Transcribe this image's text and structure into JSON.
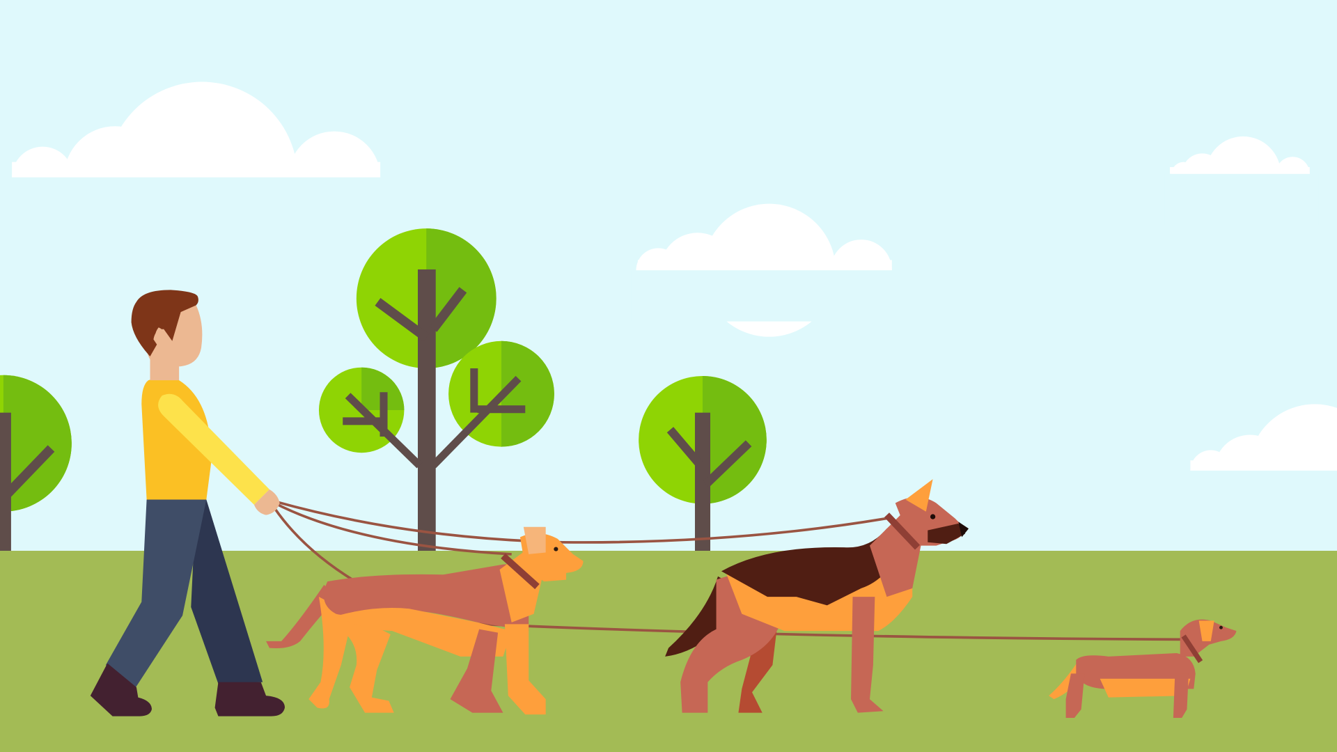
{
  "scene": {
    "description_tags": [
      "person-walking-dogs",
      "park",
      "flat-illustration"
    ],
    "colors": {
      "sky": "#dff9fc",
      "grass": "#a3bb55",
      "cloud": "#ffffff",
      "tree_foliage_light": "#8fd404",
      "tree_foliage_dark": "#74bd10",
      "tree_trunk": "#5f4d4a",
      "shirt": "#fbc024",
      "sleeve": "#fde24b",
      "pants_light": "#3f4d67",
      "pants_dark": "#2d3650",
      "shoes": "#432130",
      "hair": "#7e3518",
      "skin": "#ecb892",
      "leash": "#9a5442",
      "dog_brown": "#c66755",
      "dog_orange": "#fe9f3c",
      "dog_dark": "#501e13",
      "collar": "#8f3f35"
    }
  }
}
